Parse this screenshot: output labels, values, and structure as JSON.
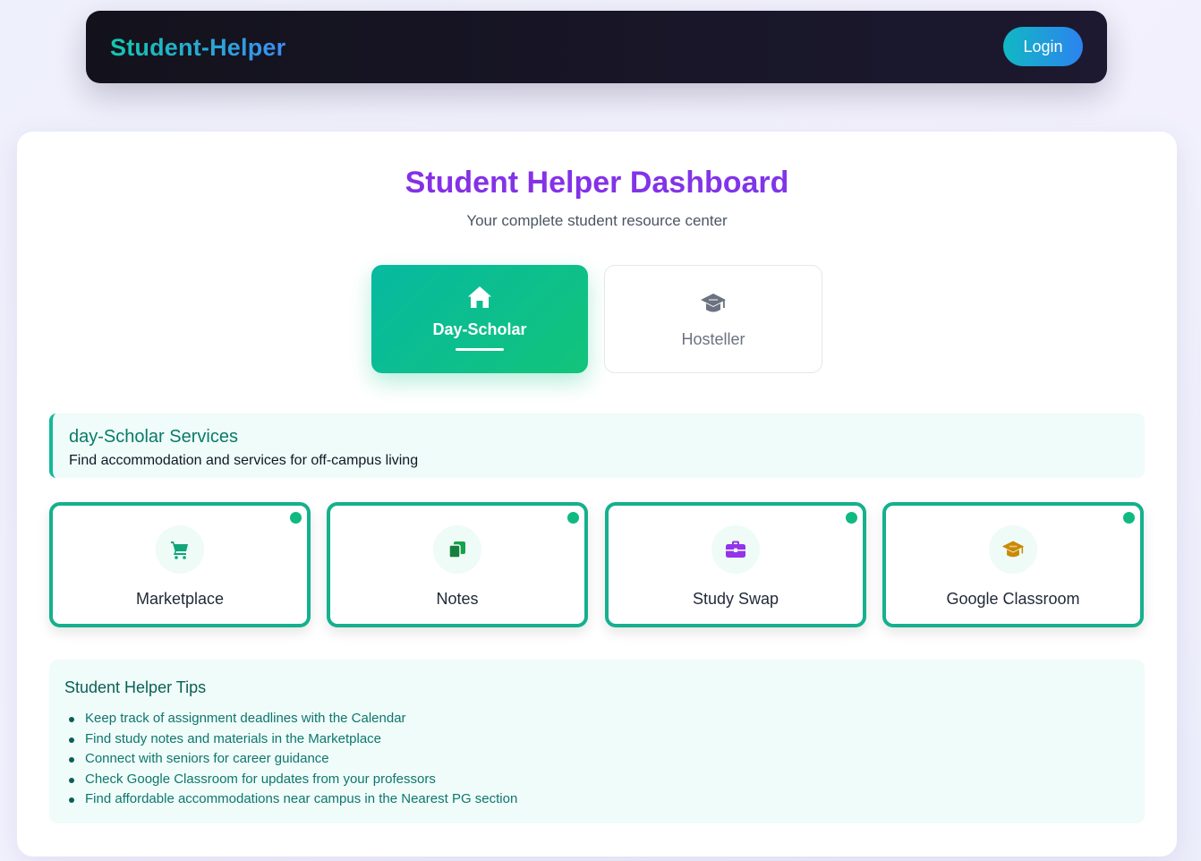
{
  "navbar": {
    "brand": "Student-Helper",
    "login_label": "Login"
  },
  "dashboard": {
    "title": "Student Helper Dashboard",
    "subtitle": "Your complete student resource center"
  },
  "modes": [
    {
      "label": "Day-Scholar",
      "icon": "home-icon",
      "selected": true
    },
    {
      "label": "Hosteller",
      "icon": "graduation-cap-icon",
      "selected": false
    }
  ],
  "services": {
    "title": "day-Scholar Services",
    "description": "Find accommodation and services for off-campus living"
  },
  "tiles": [
    {
      "label": "Marketplace",
      "icon": "cart-icon",
      "icon_color": "#10a57a"
    },
    {
      "label": "Notes",
      "icon": "copy-icon",
      "icon_color": "#16a34a"
    },
    {
      "label": "Study Swap",
      "icon": "briefcase-icon",
      "icon_color": "#9333ea"
    },
    {
      "label": "Google Classroom",
      "icon": "graduation-cap-icon",
      "icon_color": "#ca8a04"
    }
  ],
  "tips": {
    "title": "Student Helper Tips",
    "items": [
      "Keep track of assignment deadlines with the Calendar",
      "Find study notes and materials in the Marketplace",
      "Connect with seniors for career guidance",
      "Check Google Classroom for updates from your professors",
      "Find affordable accommodations near campus in the Nearest PG section"
    ]
  },
  "colors": {
    "accent_teal": "#15b08d",
    "brand_purple": "#8a2be2",
    "status_dot": "#10b981"
  }
}
